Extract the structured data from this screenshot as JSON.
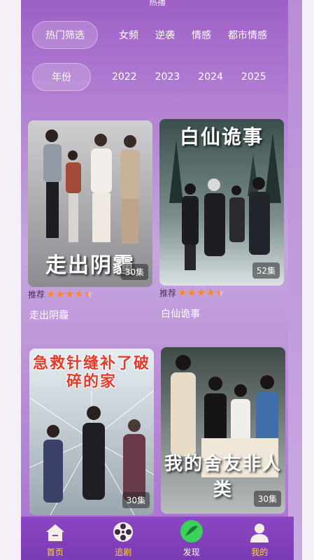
{
  "header": {
    "title": "热播"
  },
  "filters": {
    "hot": {
      "label": "热门筛选",
      "options": [
        "女频",
        "逆袭",
        "情感",
        "都市情感"
      ]
    },
    "year": {
      "label": "年份",
      "options": [
        "2022",
        "2023",
        "2024",
        "2025"
      ]
    }
  },
  "cards": [
    {
      "poster_title": "走出阴霾",
      "episodes": "30集",
      "rec_label": "推荐",
      "rating": 4.5,
      "name": "走出阴霾"
    },
    {
      "poster_title": "白仙诡事",
      "episodes": "52集",
      "rec_label": "推荐",
      "rating": 4.5,
      "name": "白仙诡事"
    },
    {
      "poster_title": "急救针缝补了破碎的家",
      "episodes": "30集"
    },
    {
      "poster_title": "我的舍友非人类",
      "episodes": "30集"
    }
  ],
  "tabbar": [
    {
      "label": "首页",
      "icon": "home-icon"
    },
    {
      "label": "追剧",
      "icon": "film-reel-icon"
    },
    {
      "label": "发现",
      "icon": "discover-icon",
      "active": true
    },
    {
      "label": "我的",
      "icon": "user-icon"
    }
  ],
  "colors": {
    "accent": "#ffd34a",
    "star": "#ff8a1f",
    "tabbar": "#7b3bb5"
  }
}
